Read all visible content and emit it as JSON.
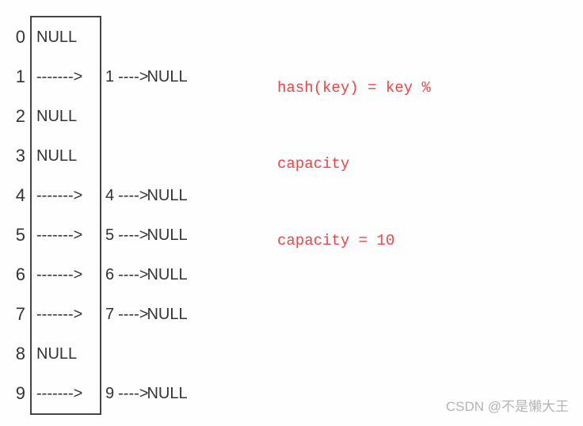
{
  "hash_table": {
    "capacity": 10,
    "rows": [
      {
        "index": "0",
        "cell": "NULL",
        "chain_value": null
      },
      {
        "index": "1",
        "cell": "-------> ",
        "chain_value": "1"
      },
      {
        "index": "2",
        "cell": "NULL",
        "chain_value": null
      },
      {
        "index": "3",
        "cell": "NULL",
        "chain_value": null
      },
      {
        "index": "4",
        "cell": "-------> ",
        "chain_value": "4"
      },
      {
        "index": "5",
        "cell": "-------> ",
        "chain_value": "5"
      },
      {
        "index": "6",
        "cell": "-------> ",
        "chain_value": "6"
      },
      {
        "index": "7",
        "cell": "-------> ",
        "chain_value": "7"
      },
      {
        "index": "8",
        "cell": "NULL",
        "chain_value": null
      },
      {
        "index": "9",
        "cell": "-------> ",
        "chain_value": "9"
      }
    ],
    "chain_arrow": "---->",
    "null_label": "NULL"
  },
  "formula": {
    "line1": "hash(key) = key %",
    "line2": "capacity",
    "line3": "capacity = 10"
  },
  "watermark": "CSDN @不是懒大王"
}
